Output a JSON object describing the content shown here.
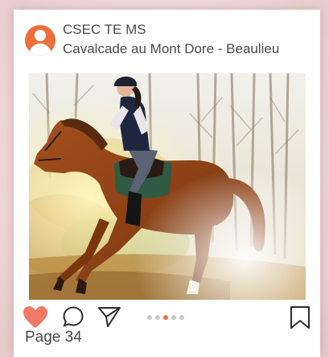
{
  "post": {
    "account_name": "CSEC TE MS",
    "location": "Cavalcade au Mont Dore - Beaulieu",
    "image_subject": "rider-on-galloping-horse"
  },
  "actions": {
    "like_icon": "heart-icon",
    "comment_icon": "comment-icon",
    "share_icon": "send-icon",
    "save_icon": "bookmark-icon",
    "carousel_total": 5,
    "carousel_active": 3
  },
  "footer": {
    "page_label": "Page 34"
  },
  "colors": {
    "accent": "#ec6f3c",
    "heart": "#f07a65",
    "active_dot": "#e8704f",
    "text": "#4a4a4a"
  }
}
